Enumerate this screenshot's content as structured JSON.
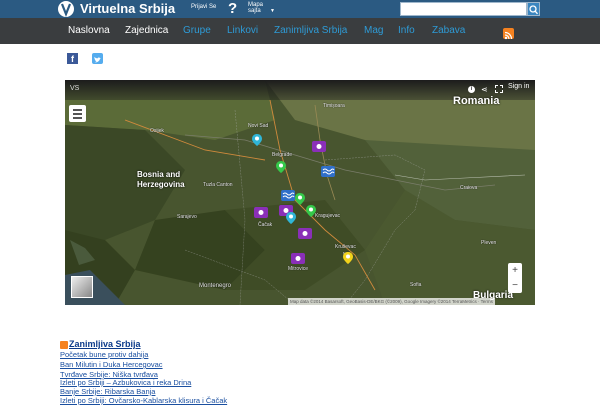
{
  "header": {
    "site_title": "Virtuelna Srbija",
    "login_label": "Prijavi Se",
    "help_symbol": "?",
    "sitemap_label": "Mapa sajta",
    "search": {
      "value": "",
      "placeholder": ""
    },
    "colors": {
      "topbar": "#2b5a82",
      "navbar": "#3a3d3f",
      "nav_active": "#ffffff",
      "nav_inactive": "#2e9bd6"
    }
  },
  "nav": {
    "items": [
      {
        "label": "Naslovna",
        "active": true
      },
      {
        "label": "Zajednica",
        "active": true
      },
      {
        "label": "Grupe",
        "active": false
      },
      {
        "label": "Linkovi",
        "active": false
      },
      {
        "label": "Zanimljiva Srbija",
        "active": false
      },
      {
        "label": "Mag",
        "active": false
      },
      {
        "label": "Info",
        "active": false
      },
      {
        "label": "Zabava",
        "active": false
      }
    ]
  },
  "share": {
    "facebook_icon": "facebook-icon",
    "twitter_icon": "twitter-icon"
  },
  "map": {
    "corner_label": "VS",
    "signin_label": "Sign in",
    "country_labels": {
      "romania": "Romania",
      "bosnia_line1": "Bosnia and",
      "bosnia_line2": "Herzegovina",
      "bulgaria": "Bulgaria"
    },
    "cities": {
      "novi_sad": "Novi Sad",
      "belgrade": "Belgrade",
      "tuzla": "Tuzla Canton",
      "sarajevo": "Sarajevo",
      "cacak": "Čačak",
      "kragujevac": "Kragujevac",
      "krusevac": "Kruševac",
      "mitrovica": "Mitrovice",
      "nis": "Niš",
      "montenegro": "Montenegro",
      "sofia": "Sofia",
      "pleven": "Pleven",
      "craiova": "Craiova",
      "timisoara": "Timișoara",
      "osijek": "Osijek"
    },
    "attribution": "Map data ©2014 Basarsoft, GeoBasis-DE/BKG (©2009), Google Imagery ©2014 TerraMetrics · Terms",
    "zoom_in": "+",
    "zoom_out": "−"
  },
  "feed": {
    "title": "Zanimljiva Srbija",
    "items": [
      "Početak bune protiv dahija",
      "Ban Milutin i Duka Hercegovac",
      "Tvrđave Srbije: Niška tvrđava",
      "Izleti po Srbiji – Azbukovica i reka Drina",
      "Banje Srbije: Ribarska Banja",
      "Izleti po Srbiji: Ovčarsko-Kablarska klisura i Čačak"
    ]
  }
}
